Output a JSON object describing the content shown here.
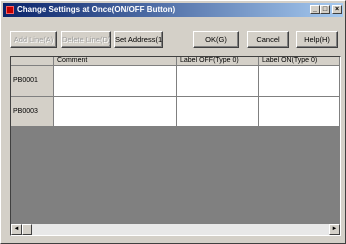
{
  "window": {
    "title": "Change Settings at Once(ON/OFF Button)",
    "minimize_glyph": "_",
    "maximize_glyph": "□",
    "close_glyph": "×"
  },
  "toolbar": {
    "add_line": "Add Line(A)",
    "delete_line": "Delete Line(D)",
    "set_address": "Set Address(1)",
    "ok": "OK(G)",
    "cancel": "Cancel",
    "help": "Help(H)"
  },
  "grid": {
    "columns": [
      "Comment",
      "Label OFF(Type 0)",
      "Label ON(Type 0)"
    ],
    "rows": [
      {
        "name": "PB0001"
      },
      {
        "name": "PB0003"
      }
    ]
  },
  "scrollbar": {
    "left_glyph": "◄",
    "right_glyph": "►"
  }
}
